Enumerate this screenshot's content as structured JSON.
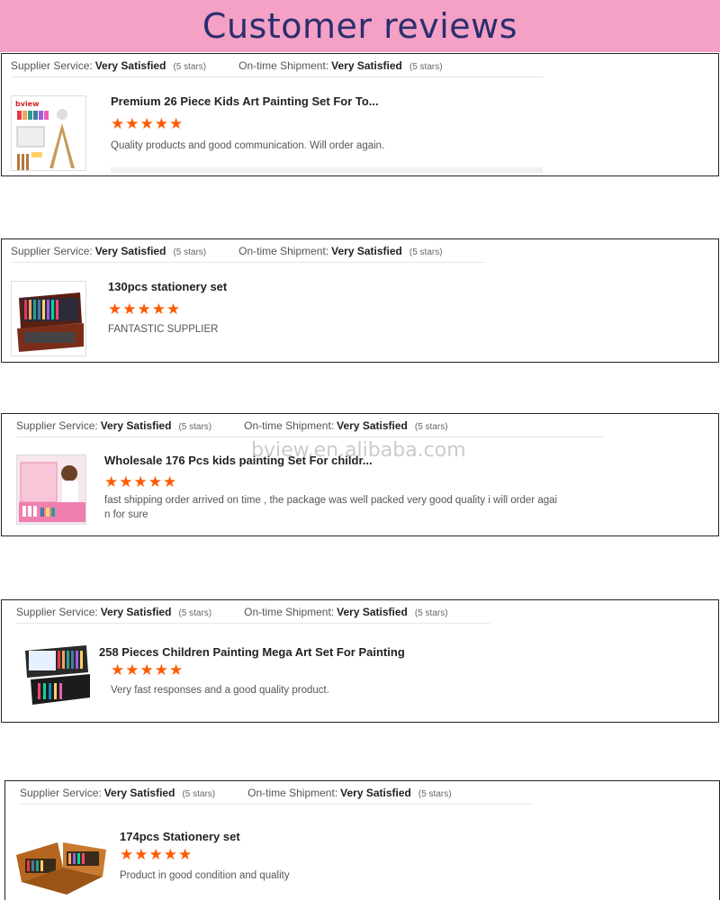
{
  "header": {
    "title": "Customer reviews"
  },
  "watermark": "bview.en.alibaba.com",
  "meta": {
    "supplier_label": "Supplier Service:",
    "shipment_label": "On-time Shipment:",
    "value": "Very Satisfied",
    "stars": "(5 stars)"
  },
  "rating_stars": "★★★★★",
  "colors": {
    "banner": "#f4a1c5",
    "banner_text": "#2a2e6e",
    "star": "#ff5a00"
  },
  "reviews": [
    {
      "title": "Premium 26 Piece Kids Art Painting Set For To...",
      "text": "Quality products and good communication. Will order again.",
      "thumb_brand": "bview",
      "rating": 5
    },
    {
      "title": "130pcs stationery set",
      "text": "FANTASTIC SUPPLIER",
      "rating": 5
    },
    {
      "title": "Wholesale 176 Pcs kids painting Set For childr...",
      "text": "fast shipping order arrived on time , the package was well packed very good quality i will order again for sure",
      "rating": 5
    },
    {
      "title": "258 Pieces Children Painting Mega Art Set For Painting",
      "text": "Very fast responses and a good quality product.",
      "rating": 5
    },
    {
      "title": "174pcs Stationery set",
      "text": "Product in good condition and quality",
      "rating": 5
    }
  ]
}
